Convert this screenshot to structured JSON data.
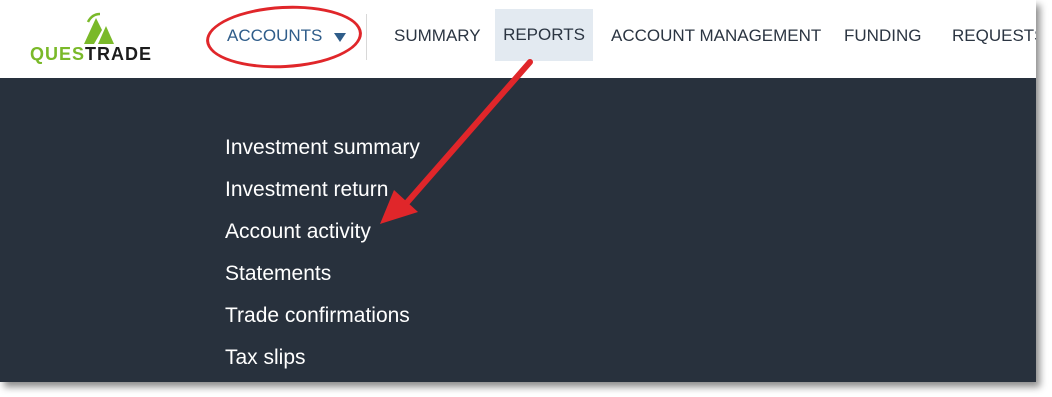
{
  "logo": {
    "text_q": "QUES",
    "text_rest": "TRADE",
    "brand_color": "#7ab929"
  },
  "nav": {
    "accounts": "ACCOUNTS",
    "summary": "SUMMARY",
    "reports": "REPORTS",
    "account_management": "ACCOUNT MANAGEMENT",
    "funding": "FUNDING",
    "requests": "REQUESTS"
  },
  "dropdown": {
    "items": [
      "Investment summary",
      "Investment return",
      "Account activity",
      "Statements",
      "Trade confirmations",
      "Tax slips"
    ]
  },
  "colors": {
    "dropdown_bg": "#28313d",
    "highlight_red": "#e0262a",
    "accent_blue": "#2f5d8a",
    "reports_bg": "#e3eaf1"
  }
}
